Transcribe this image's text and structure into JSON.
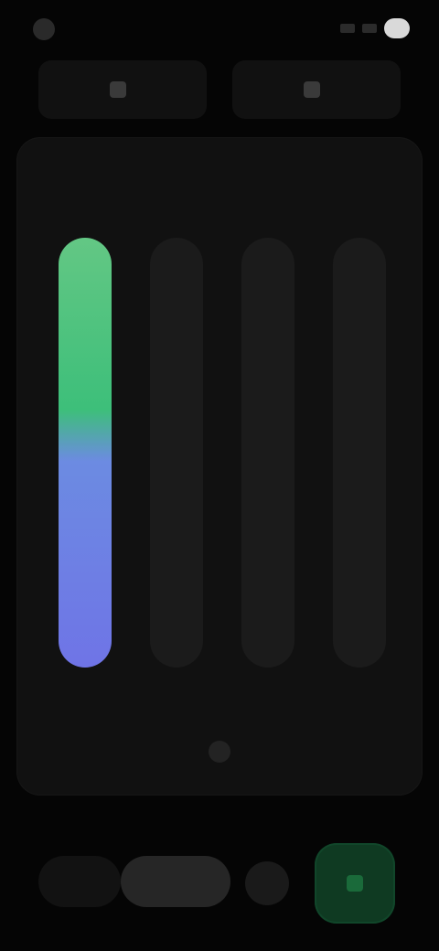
{
  "status": {
    "time": "",
    "battery": ""
  },
  "tabs": [
    {
      "label": "",
      "icon": "tab-icon"
    },
    {
      "label": "",
      "icon": "tab-icon"
    }
  ],
  "card": {
    "title": "",
    "bars": [
      {
        "label": "",
        "value": 1.0
      },
      {
        "label": "",
        "value": 0
      },
      {
        "label": "",
        "value": 0
      },
      {
        "label": "",
        "value": 0
      }
    ]
  },
  "bottom": {
    "left_label": "",
    "mid_label": "",
    "small_label": "",
    "go_label": ""
  },
  "colors": {
    "accent_green": "#3dbf7a",
    "accent_blue": "#6f74e6",
    "background": "#050505",
    "card": "#111111"
  }
}
